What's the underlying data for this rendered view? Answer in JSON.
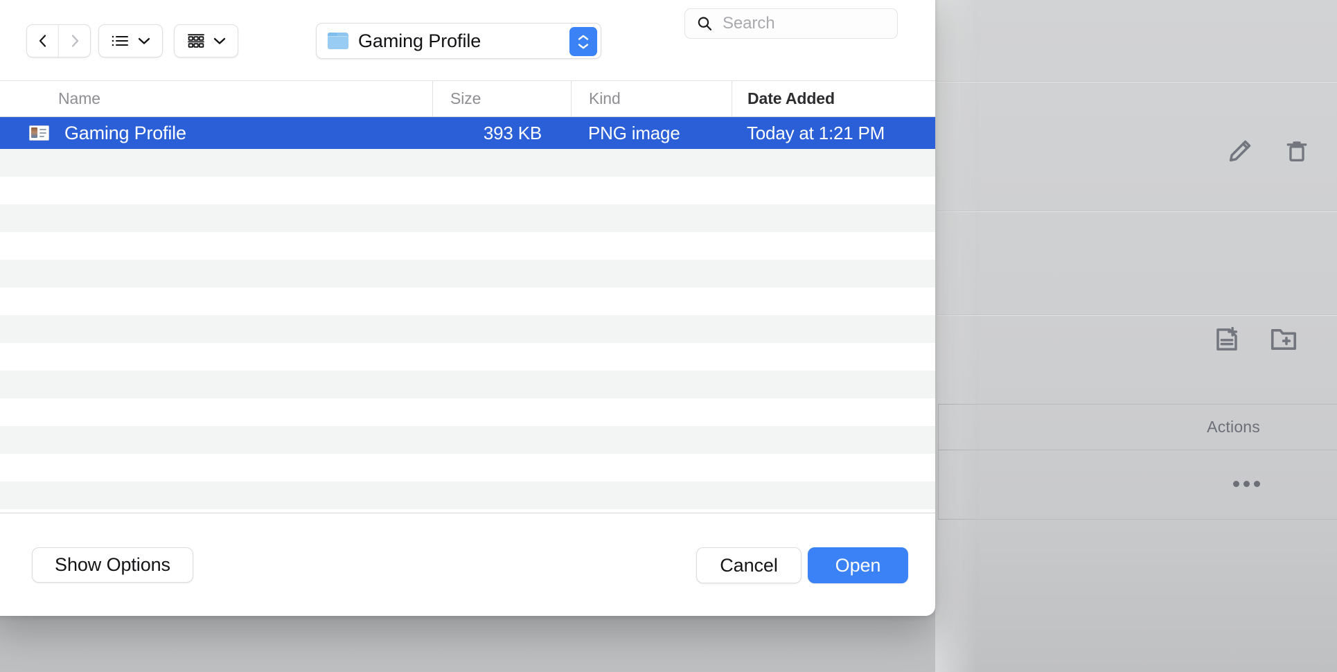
{
  "background_app": {
    "icons": [
      {
        "name": "edit-pencil-icon",
        "label": "Edit"
      },
      {
        "name": "trash-icon",
        "label": "Delete"
      },
      {
        "name": "add-file-icon",
        "label": "Add File"
      },
      {
        "name": "add-folder-icon",
        "label": "Add Folder"
      }
    ],
    "table": {
      "column_header": "Actions",
      "row_action_label": "•••"
    },
    "dim_color": "#cdced0"
  },
  "dialog": {
    "toolbar": {
      "back_icon": "chevron-left-icon",
      "forward_icon": "chevron-right-icon",
      "back_enabled": true,
      "forward_enabled": false,
      "view_list_icon": "list-view-icon",
      "view_grid_icon": "grid-view-icon",
      "view_dropdown_icon": "chevron-down-icon",
      "location": {
        "folder_icon": "folder-icon",
        "label": "Gaming Profile",
        "stepper_icon": "up-down-chevrons-icon",
        "stepper_color": "#3b82f6"
      },
      "search": {
        "icon": "search-icon",
        "value": "",
        "placeholder": "Search"
      }
    },
    "columns": [
      {
        "key": "name",
        "label": "Name",
        "sorted": false
      },
      {
        "key": "size",
        "label": "Size",
        "sorted": false
      },
      {
        "key": "kind",
        "label": "Kind",
        "sorted": false
      },
      {
        "key": "date_added",
        "label": "Date Added",
        "sorted": true
      }
    ],
    "files": [
      {
        "icon": "image-file-icon",
        "name": "Gaming Profile",
        "size": "393 KB",
        "kind": "PNG image",
        "date_added": "Today at 1:21 PM",
        "selected": true
      }
    ],
    "empty_row_count": 16,
    "selection_color": "#2a5fd7",
    "footer": {
      "show_options_label": "Show Options",
      "cancel_label": "Cancel",
      "open_label": "Open",
      "primary_color": "#3b82f6"
    }
  }
}
